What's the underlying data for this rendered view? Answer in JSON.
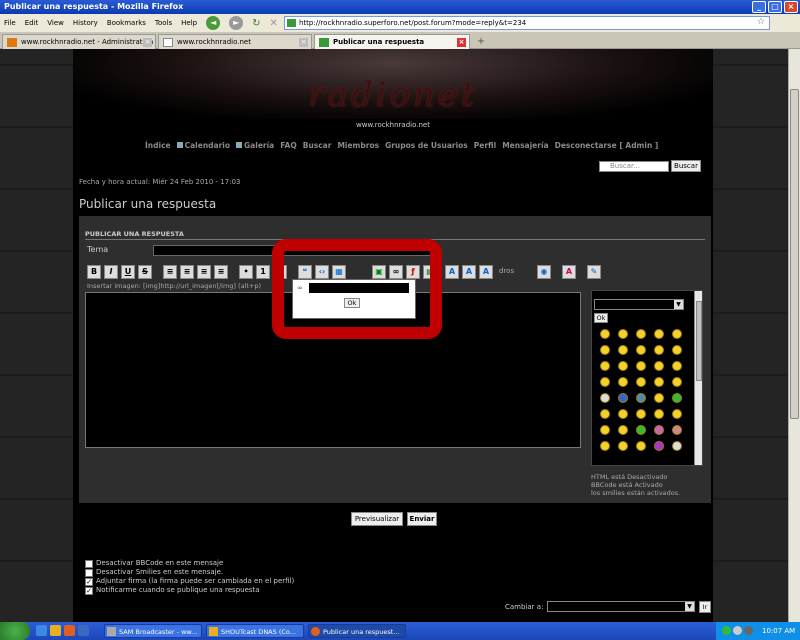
{
  "window": {
    "title": "Publicar una respuesta - Mozilla Firefox"
  },
  "menu": [
    "File",
    "Edit",
    "View",
    "History",
    "Bookmarks",
    "Tools",
    "Help"
  ],
  "url": "http://rockhnradio.superforo.net/post.forum?mode=reply&t=234",
  "tabs": [
    {
      "label": "www.rockhnradio.net - Administration"
    },
    {
      "label": "www.rockhnradio.net"
    },
    {
      "label": "Publicar una respuesta"
    }
  ],
  "site": {
    "logo": "radionet",
    "url_text": "www.rockhnradio.net",
    "nav": [
      "Índice",
      "Calendario",
      "Galería",
      "FAQ",
      "Buscar",
      "Miembros",
      "Grupos de Usuarios",
      "Perfil",
      "Mensajería",
      "Desconectarse [ Admin ]"
    ],
    "search_placeholder": "Buscar...",
    "search_button": "Buscar",
    "datetime": "Fecha y hora actual: Miér 24 Feb 2010 - 17:03",
    "page_title": "Publicar una respuesta"
  },
  "form": {
    "section_header": "PUBLICAR UNA RESPUESTA",
    "tema_label": "Tema",
    "tema_value": "",
    "toolbar": [
      "B",
      "I",
      "U",
      "S"
    ],
    "toolbar_fragment": "dros",
    "insert_image_hint": "Insertar imagen: [img]http://url_imagen[/img] (alt+p)",
    "link_popup_ok": "Ok",
    "smilies_ok": "Ok",
    "bbcode_info": [
      "HTML está Desactivado",
      "BBCode está Activado",
      "los smilies están activados."
    ],
    "preview_button": "Previsualizar",
    "send_button": "Enviar"
  },
  "options": [
    {
      "label": "Desactivar BBCode en este mensaje",
      "checked": false
    },
    {
      "label": "Desactivar Smilies en este mensaje.",
      "checked": false
    },
    {
      "label": "Adjuntar firma (la firma puede ser cambiada en el perfil)",
      "checked": true
    },
    {
      "label": "Notificarme cuando se publique una respuesta",
      "checked": true
    }
  ],
  "jump": {
    "label": "Cambiar a:",
    "button": "Ir"
  },
  "taskbar": {
    "tasks": [
      {
        "label": "SAM Broadcaster - ww..."
      },
      {
        "label": "SHOUTcast DNAS (Co..."
      },
      {
        "label": "Publicar una respuest..."
      }
    ],
    "clock": "10:07 AM"
  },
  "colors": {
    "accent_red": "#c00000",
    "titlebar": "#0a3bb0"
  }
}
